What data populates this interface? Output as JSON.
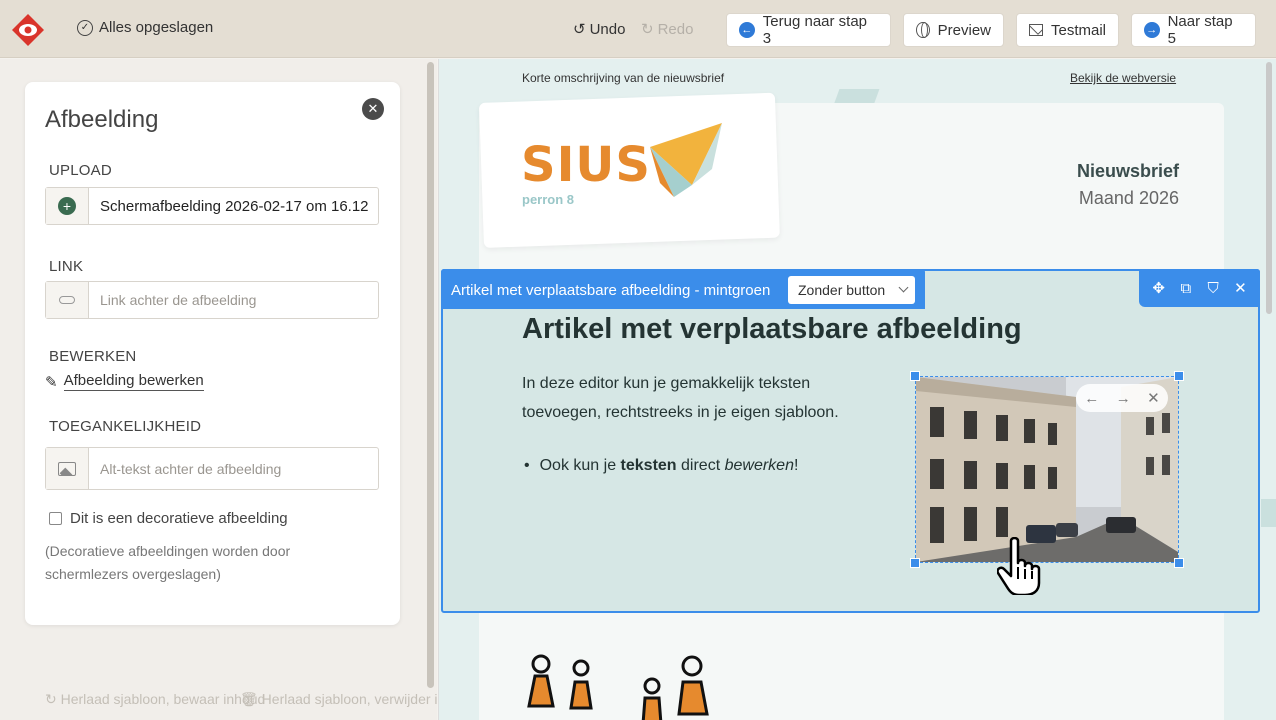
{
  "topbar": {
    "saved_label": "Alles opgeslagen",
    "undo_label": "Undo",
    "redo_label": "Redo",
    "back_label": "Terug naar stap 3",
    "preview_label": "Preview",
    "testmail_label": "Testmail",
    "next_label": "Naar stap 5"
  },
  "panel": {
    "title": "Afbeelding",
    "upload_label": "UPLOAD",
    "upload_value": "Schermafbeelding 2026-02-17 om 16.12",
    "link_label": "LINK",
    "link_placeholder": "Link achter de afbeelding",
    "edit_label": "BEWERKEN",
    "edit_link": "Afbeelding bewerken",
    "a11y_label": "TOEGANKELIJKHEID",
    "alt_placeholder": "Alt-tekst achter de afbeelding",
    "decorative_label": "Dit is een decoratieve afbeelding",
    "decorative_note": "(Decoratieve afbeeldingen worden door schermlezers overgeslagen)"
  },
  "footer": {
    "reload_keep": "Herlaad sjabloon, bewaar inhoud",
    "reload_delete": "Herlaad sjabloon, verwijder inhoud"
  },
  "preview": {
    "short_desc": "Korte omschrijving van de nieuwsbrief",
    "webversion": "Bekijk de webversie",
    "logo_text": "SIUS",
    "logo_sub": "perron 8",
    "newsletter": "Nieuwsbrief",
    "month": "Maand 2026",
    "block_name": "Artikel met verplaatsbare afbeelding - mintgroen",
    "button_select": "Zonder button",
    "article_title": "Artikel met verplaatsbare afbeelding",
    "article_text": "In deze editor kun je gemakkelijk teksten toevoegen, rechtstreeks in je eigen sjabloon.",
    "bullet_a": "Ook kun je ",
    "bullet_bold": "teksten",
    "bullet_b": " direct ",
    "bullet_em": "bewerken",
    "bullet_c": "!"
  },
  "colors": {
    "accent": "#3b8dea",
    "brand_orange": "#e68a2e",
    "topbar": "#e4ded3",
    "mint": "#d6e7e5"
  }
}
